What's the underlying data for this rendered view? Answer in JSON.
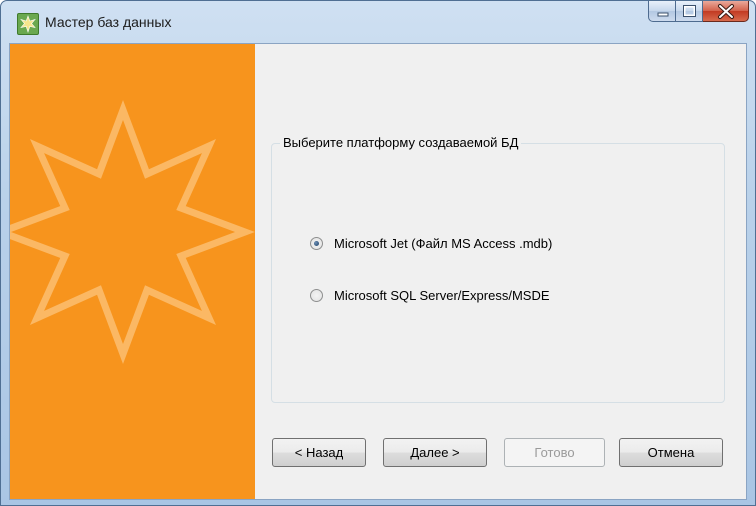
{
  "window": {
    "title": "Мастер баз данных",
    "icon": "wizard-star-icon",
    "caption_buttons": [
      "minimize-icon",
      "maximize-icon",
      "close-icon"
    ]
  },
  "sidebar": {
    "color": "#f7941d",
    "decoration": "star-icon"
  },
  "group": {
    "caption": "Выберите платформу создаваемой БД",
    "options": [
      {
        "label": "Microsoft Jet (Файл MS Access .mdb)",
        "selected": true
      },
      {
        "label": "Microsoft SQL Server/Express/MSDE",
        "selected": false
      }
    ]
  },
  "buttons": {
    "back": "< Назад",
    "next": "Далее >",
    "finish": "Готово",
    "cancel": "Отмена"
  }
}
